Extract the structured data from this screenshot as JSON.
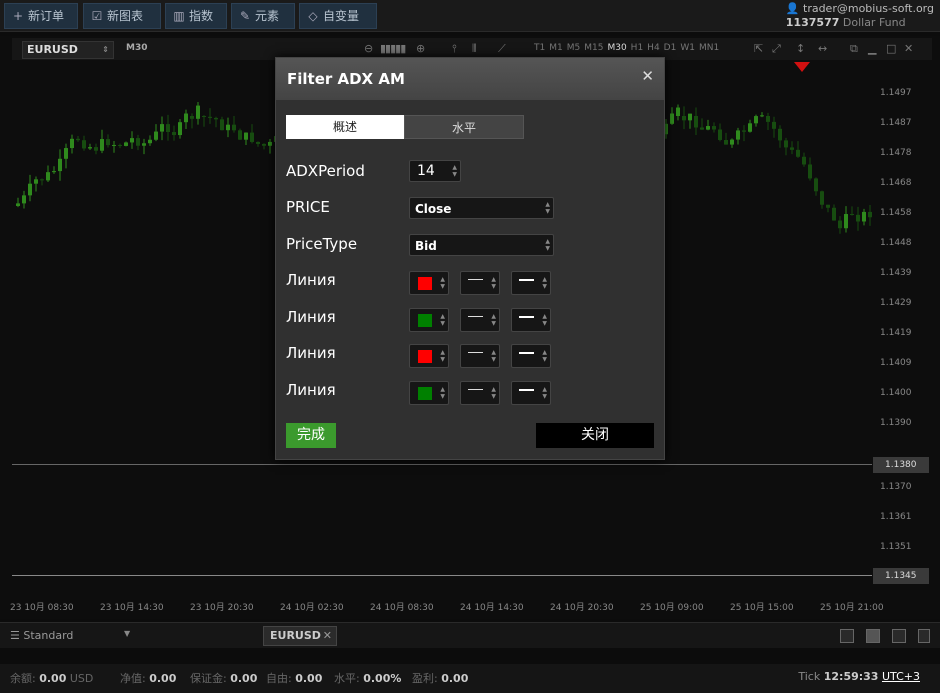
{
  "toolbar": {
    "new_order": "新订单",
    "new_chart": "新图表",
    "indicators": "指数",
    "elements": "元素",
    "variables": "自变量"
  },
  "account": {
    "user": "trader@mobius-soft.org",
    "number": "1137577",
    "fund": "Dollar Fund"
  },
  "chart": {
    "symbol": "EURUSD",
    "timeframe": "M30",
    "timeframes": [
      "T1",
      "M1",
      "M5",
      "M15",
      "M30",
      "H1",
      "H4",
      "D1",
      "W1",
      "MN1"
    ],
    "active_timeframe": "M30",
    "price_labels": [
      "1.1497",
      "1.1487",
      "1.1478",
      "1.1468",
      "1.1458",
      "1.1448",
      "1.1439",
      "1.1429",
      "1.1419",
      "1.1409",
      "1.1400",
      "1.1390",
      "1.1370",
      "1.1361",
      "1.1351"
    ],
    "current_price": "1.1380",
    "low_price": "1.1345",
    "time_labels": [
      "23 10月 08:30",
      "23 10月 14:30",
      "23 10月 20:30",
      "24 10月 02:30",
      "24 10月 08:30",
      "24 10月 14:30",
      "24 10月 20:30",
      "25 10月 09:00",
      "25 10月 15:00",
      "25 10月 21:00"
    ],
    "colors": {
      "up": "#2f8a1d",
      "down": "#174d10",
      "bg": "#0d0d0d"
    }
  },
  "dialog": {
    "title": "Filter ADX AM",
    "tab_overview": "概述",
    "tab_levels": "水平",
    "adx_label": "ADXPeriod",
    "adx_value": "14",
    "price_label": "PRICE",
    "price_value": "Close",
    "pricetype_label": "PriceType",
    "pricetype_value": "Bid",
    "lines": [
      {
        "label": "Линия",
        "color": "#ff0000"
      },
      {
        "label": "Линия",
        "color": "#008000"
      },
      {
        "label": "Линия",
        "color": "#ff0000"
      },
      {
        "label": "Линия",
        "color": "#008000"
      }
    ],
    "done": "完成",
    "close": "关闭"
  },
  "bottom": {
    "template": "Standard",
    "tab": "EURUSD"
  },
  "status": {
    "balance_label": "余额:",
    "balance": "0.00",
    "currency": "USD",
    "equity_label": "净值:",
    "equity": "0.00",
    "margin_label": "保证金:",
    "margin": "0.00",
    "free_label": "自由:",
    "free": "0.00",
    "level_label": "水平:",
    "level": "0.00%",
    "profit_label": "盈利:",
    "profit": "0.00",
    "tick_label": "Tick",
    "tick_time": "12:59:33",
    "utc": "UTC+3"
  }
}
